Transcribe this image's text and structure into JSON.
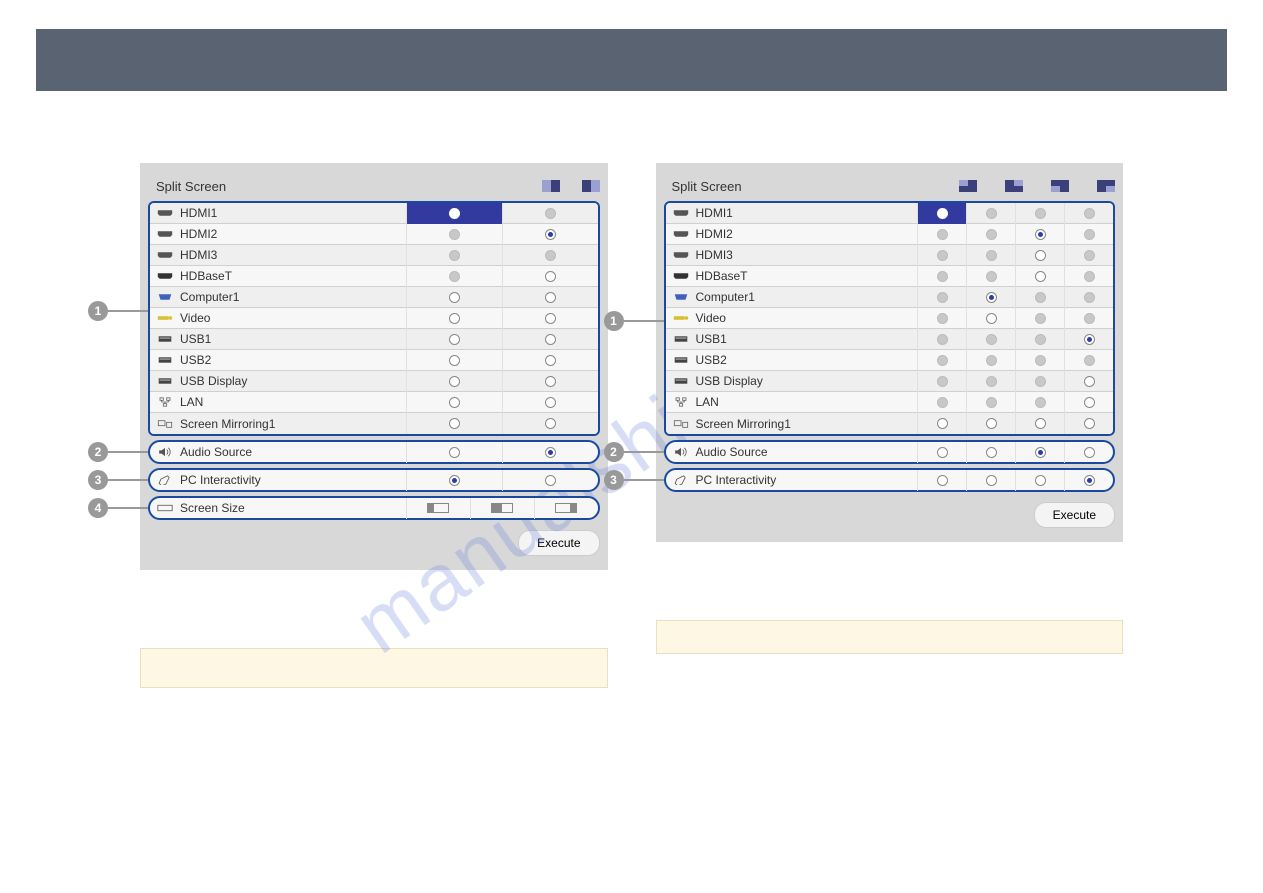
{
  "panel_title": "Split Screen",
  "execute_label": "Execute",
  "watermark": "manualshive.com",
  "left": {
    "sources": [
      {
        "label": "HDMI1",
        "icon": "hdmi",
        "cols": [
          "selected",
          "disabled"
        ]
      },
      {
        "label": "HDMI2",
        "icon": "hdmi",
        "cols": [
          "disabled",
          "on"
        ]
      },
      {
        "label": "HDMI3",
        "icon": "hdmi",
        "cols": [
          "disabled",
          "disabled"
        ]
      },
      {
        "label": "HDBaseT",
        "icon": "hdbt",
        "cols": [
          "disabled",
          "off"
        ]
      },
      {
        "label": "Computer1",
        "icon": "vga",
        "cols": [
          "off",
          "off"
        ]
      },
      {
        "label": "Video",
        "icon": "rca",
        "cols": [
          "off",
          "off"
        ]
      },
      {
        "label": "USB1",
        "icon": "usb",
        "cols": [
          "off",
          "off"
        ]
      },
      {
        "label": "USB2",
        "icon": "usb",
        "cols": [
          "off",
          "off"
        ]
      },
      {
        "label": "USB Display",
        "icon": "usb",
        "cols": [
          "off",
          "off"
        ]
      },
      {
        "label": "LAN",
        "icon": "lan",
        "cols": [
          "off",
          "off"
        ]
      },
      {
        "label": "Screen Mirroring1",
        "icon": "mirror",
        "cols": [
          "off",
          "off"
        ]
      }
    ],
    "audio": {
      "label": "Audio Source",
      "icon": "speaker",
      "cols": [
        "off",
        "on"
      ]
    },
    "pcint": {
      "label": "PC Interactivity",
      "icon": "pen",
      "cols": [
        "on",
        "off"
      ]
    },
    "size": {
      "label": "Screen Size",
      "icon": "size"
    }
  },
  "right": {
    "sources": [
      {
        "label": "HDMI1",
        "icon": "hdmi",
        "cols": [
          "selected",
          "disabled",
          "disabled",
          "disabled"
        ]
      },
      {
        "label": "HDMI2",
        "icon": "hdmi",
        "cols": [
          "disabled",
          "disabled",
          "on",
          "disabled"
        ]
      },
      {
        "label": "HDMI3",
        "icon": "hdmi",
        "cols": [
          "disabled",
          "disabled",
          "off",
          "disabled"
        ]
      },
      {
        "label": "HDBaseT",
        "icon": "hdbt",
        "cols": [
          "disabled",
          "disabled",
          "off",
          "disabled"
        ]
      },
      {
        "label": "Computer1",
        "icon": "vga",
        "cols": [
          "disabled",
          "on",
          "disabled",
          "disabled"
        ]
      },
      {
        "label": "Video",
        "icon": "rca",
        "cols": [
          "disabled",
          "off",
          "disabled",
          "disabled"
        ]
      },
      {
        "label": "USB1",
        "icon": "usb",
        "cols": [
          "disabled",
          "disabled",
          "disabled",
          "on"
        ]
      },
      {
        "label": "USB2",
        "icon": "usb",
        "cols": [
          "disabled",
          "disabled",
          "disabled",
          "disabled"
        ]
      },
      {
        "label": "USB Display",
        "icon": "usb",
        "cols": [
          "disabled",
          "disabled",
          "disabled",
          "off"
        ]
      },
      {
        "label": "LAN",
        "icon": "lan",
        "cols": [
          "disabled",
          "disabled",
          "disabled",
          "off"
        ]
      },
      {
        "label": "Screen Mirroring1",
        "icon": "mirror",
        "cols": [
          "off",
          "off",
          "off",
          "off"
        ]
      }
    ],
    "audio": {
      "label": "Audio Source",
      "icon": "speaker",
      "cols": [
        "off",
        "off",
        "on",
        "off"
      ]
    },
    "pcint": {
      "label": "PC Interactivity",
      "icon": "pen",
      "cols": [
        "off",
        "off",
        "off",
        "on"
      ]
    }
  }
}
